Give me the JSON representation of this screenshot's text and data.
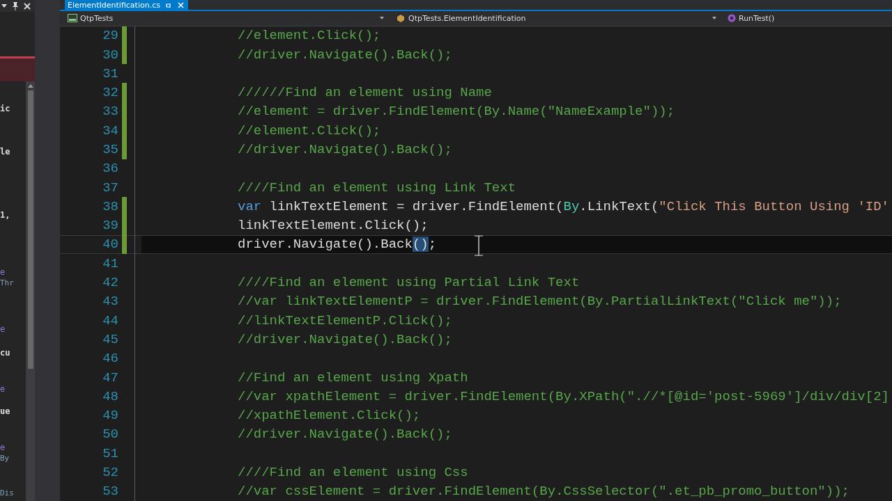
{
  "side_panel": {
    "fragments": [
      {
        "kind": "plain",
        "text": "ic"
      },
      {
        "kind": "plain",
        "text": "le"
      },
      {
        "kind": "plain",
        "text": "1,"
      },
      {
        "kind": "keyword",
        "text": "e"
      },
      {
        "kind": "hint",
        "text": "Thr"
      },
      {
        "kind": "keyword",
        "text": "e"
      },
      {
        "kind": "plain",
        "text": "cu"
      },
      {
        "kind": "keyword",
        "text": "e"
      },
      {
        "kind": "plain",
        "text": "ue"
      },
      {
        "kind": "keyword",
        "text": "e"
      },
      {
        "kind": "hint",
        "text": "By"
      },
      {
        "kind": "hint",
        "text": "Dis"
      }
    ]
  },
  "tab": {
    "label": "ElementIdentification.cs",
    "selected": true
  },
  "nav_bar": {
    "project": "QtpTests",
    "class": "QtpTests.ElementIdentification",
    "member": "RunTest()"
  },
  "editor": {
    "lines": [
      {
        "number": "29",
        "changed": true,
        "current": false,
        "tokens": [
          {
            "kind": "comment",
            "text": "//element.Click();"
          }
        ]
      },
      {
        "number": "30",
        "changed": true,
        "current": false,
        "tokens": [
          {
            "kind": "comment",
            "text": "//driver.Navigate().Back();"
          }
        ]
      },
      {
        "number": "31",
        "changed": false,
        "current": false
      },
      {
        "number": "32",
        "changed": true,
        "current": false,
        "tokens": [
          {
            "kind": "comment",
            "text": "//////Find an element using Name"
          }
        ]
      },
      {
        "number": "33",
        "changed": true,
        "current": false,
        "tokens": [
          {
            "kind": "comment",
            "text": "//element = driver.FindElement(By.Name(\"NameExample\"));"
          }
        ]
      },
      {
        "number": "34",
        "changed": true,
        "current": false,
        "tokens": [
          {
            "kind": "comment",
            "text": "//element.Click();"
          }
        ]
      },
      {
        "number": "35",
        "changed": true,
        "current": false,
        "tokens": [
          {
            "kind": "comment",
            "text": "//driver.Navigate().Back();"
          }
        ]
      },
      {
        "number": "36",
        "changed": false,
        "current": false
      },
      {
        "number": "37",
        "changed": false,
        "current": false,
        "tokens": [
          {
            "kind": "comment",
            "text": "////Find an element using Link Text"
          }
        ]
      },
      {
        "number": "38",
        "changed": true,
        "current": false,
        "tokens": [
          {
            "kind": "keyword",
            "text": "var"
          },
          {
            "kind": "plain",
            "text": " linkTextElement = driver.FindElement("
          },
          {
            "kind": "type",
            "text": "By"
          },
          {
            "kind": "plain",
            "text": ".LinkText("
          },
          {
            "kind": "string",
            "text": "\"Click This Button Using 'ID'"
          }
        ]
      },
      {
        "number": "39",
        "changed": true,
        "current": false,
        "tokens": [
          {
            "kind": "plain",
            "text": "linkTextElement.Click();"
          }
        ]
      },
      {
        "number": "40",
        "changed": true,
        "current": true,
        "tokens": [
          {
            "kind": "plain",
            "text": "driver.Navigate().Back"
          },
          {
            "kind": "match",
            "text": "()"
          },
          {
            "kind": "plain",
            "text": ";"
          }
        ]
      },
      {
        "number": "41",
        "changed": false,
        "current": false
      },
      {
        "number": "42",
        "changed": false,
        "current": false,
        "tokens": [
          {
            "kind": "comment",
            "text": "////Find an element using Partial Link Text"
          }
        ]
      },
      {
        "number": "43",
        "changed": false,
        "current": false,
        "tokens": [
          {
            "kind": "comment",
            "text": "//var linkTextElementP = driver.FindElement(By.PartialLinkText(\"Click me\"));"
          }
        ]
      },
      {
        "number": "44",
        "changed": false,
        "current": false,
        "tokens": [
          {
            "kind": "comment",
            "text": "//linkTextElementP.Click();"
          }
        ]
      },
      {
        "number": "45",
        "changed": false,
        "current": false,
        "tokens": [
          {
            "kind": "comment",
            "text": "//driver.Navigate().Back();"
          }
        ]
      },
      {
        "number": "46",
        "changed": false,
        "current": false
      },
      {
        "number": "47",
        "changed": false,
        "current": false,
        "tokens": [
          {
            "kind": "comment",
            "text": "//Find an element using Xpath"
          }
        ]
      },
      {
        "number": "48",
        "changed": false,
        "current": false,
        "tokens": [
          {
            "kind": "comment",
            "text": "//var xpathElement = driver.FindElement(By.XPath(\".//*[@id='post-5969']/div/div[2]"
          }
        ]
      },
      {
        "number": "49",
        "changed": false,
        "current": false,
        "tokens": [
          {
            "kind": "comment",
            "text": "//xpathElement.Click();"
          }
        ]
      },
      {
        "number": "50",
        "changed": false,
        "current": false,
        "tokens": [
          {
            "kind": "comment",
            "text": "//driver.Navigate().Back();"
          }
        ]
      },
      {
        "number": "51",
        "changed": false,
        "current": false
      },
      {
        "number": "52",
        "changed": false,
        "current": false,
        "tokens": [
          {
            "kind": "comment",
            "text": "////Find an element using Css"
          }
        ]
      },
      {
        "number": "53",
        "changed": false,
        "current": false,
        "tokens": [
          {
            "kind": "comment",
            "text": "//var cssElement = driver.FindElement(By.CssSelector(\".et_pb_promo_button\"));"
          }
        ]
      }
    ]
  }
}
